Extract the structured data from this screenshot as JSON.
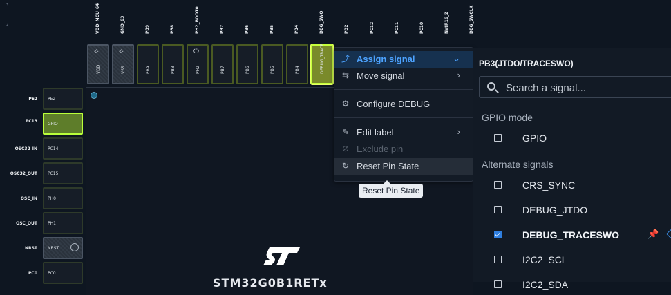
{
  "top_pins": [
    {
      "label": "VDD_MCU_64",
      "pin": "VDD",
      "kind": "power"
    },
    {
      "label": "GND_63",
      "pin": "VSS",
      "kind": "power"
    },
    {
      "label": "PB9",
      "pin": "PB9",
      "kind": "io"
    },
    {
      "label": "PB8",
      "pin": "PB8",
      "kind": "io"
    },
    {
      "label": "PH2_BOOT0",
      "pin": "PH2",
      "kind": "io"
    },
    {
      "label": "PB7",
      "pin": "PB7",
      "kind": "io"
    },
    {
      "label": "PB6",
      "pin": "PB6",
      "kind": "io"
    },
    {
      "label": "PB5",
      "pin": "PB5",
      "kind": "io"
    },
    {
      "label": "PB4",
      "pin": "PB4",
      "kind": "io"
    },
    {
      "label": "DBG_SWO",
      "pin": "DEBUG_TRACE...",
      "kind": "selected"
    },
    {
      "label": "PD2",
      "pin": "",
      "kind": "io"
    },
    {
      "label": "PC12",
      "pin": "",
      "kind": "io"
    },
    {
      "label": "PC11",
      "pin": "",
      "kind": "io"
    },
    {
      "label": "PC10",
      "pin": "",
      "kind": "io"
    },
    {
      "label": "NetR16_2",
      "pin": "",
      "kind": "io"
    },
    {
      "label": "DBG_SWCLK",
      "pin": "",
      "kind": "io"
    }
  ],
  "left_pins": [
    {
      "label": "PE2",
      "pin": "PE2",
      "kind": "io"
    },
    {
      "label": "PC13",
      "pin": "GPIO",
      "kind": "gpio"
    },
    {
      "label": "OSC32_IN",
      "pin": "PC14",
      "kind": "io"
    },
    {
      "label": "OSC32_OUT",
      "pin": "PC15",
      "kind": "io"
    },
    {
      "label": "OSC_IN",
      "pin": "PH0",
      "kind": "io"
    },
    {
      "label": "OSC_OUT",
      "pin": "PH1",
      "kind": "io"
    },
    {
      "label": "NRST",
      "pin": "NRST",
      "kind": "reset"
    },
    {
      "label": "PC0",
      "pin": "PC0",
      "kind": "io"
    }
  ],
  "chip": {
    "part_number": "STM32G0B1RETx"
  },
  "context_menu": {
    "assign_signal": "Assign signal",
    "move_signal": "Move signal",
    "configure_debug": "Configure DEBUG",
    "edit_label": "Edit label",
    "exclude_pin": "Exclude pin",
    "reset_pin_state": "Reset Pin State"
  },
  "tooltip": "Reset Pin State",
  "signal_panel": {
    "title": "PB3(JTDO/TRACESWO)",
    "search_placeholder": "Search a signal...",
    "gpio_header": "GPIO mode",
    "alt_header": "Alternate signals",
    "gpio_signals": [
      {
        "name": "GPIO",
        "checked": false
      }
    ],
    "alt_signals": [
      {
        "name": "CRS_SYNC",
        "checked": false
      },
      {
        "name": "DEBUG_JTDO",
        "checked": false
      },
      {
        "name": "DEBUG_TRACESWO",
        "checked": true
      },
      {
        "name": "I2C2_SCL",
        "checked": false
      },
      {
        "name": "I2C2_SDA",
        "checked": false
      }
    ]
  },
  "colors": {
    "selected_pin": "#c5ff3a",
    "accent": "#4da3ff",
    "checkbox": "#2f7fe0"
  }
}
